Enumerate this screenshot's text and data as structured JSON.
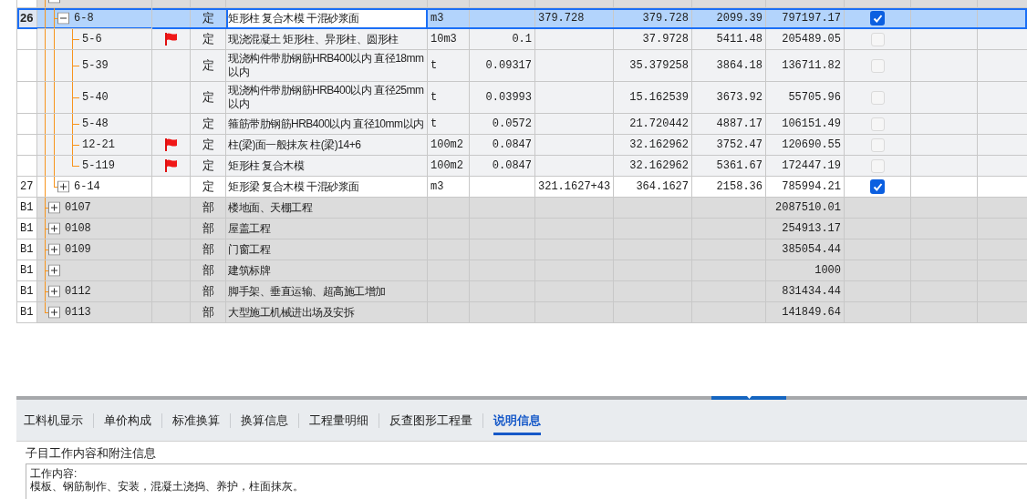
{
  "table": {
    "rows": [
      {
        "kind": "section",
        "expanded": true,
        "selected": false,
        "children": [
          {
            "kind": "item",
            "number": "26",
            "code": "6-8",
            "expanded": true,
            "selected": true,
            "flagged": false,
            "type": "定",
            "name": "矩形柱 复合木模 干混砂浆面",
            "unit": "m3",
            "expression": "379.728",
            "quantity": "379.728",
            "unit_price": "2099.39",
            "total": "797197.17",
            "checked": true,
            "children": [
              {
                "kind": "sub",
                "code": "5-6",
                "selected": false,
                "flagged": true,
                "type": "定",
                "name": "现浇混凝土 矩形柱、异形柱、圆形柱",
                "unit": "10m3",
                "content": "0.1",
                "quantity": "37.9728",
                "unit_price": "5411.48",
                "total": "205489.05",
                "checked": false
              },
              {
                "kind": "sub",
                "code": "5-39",
                "selected": false,
                "flagged": false,
                "type": "定",
                "name": "现浇构件带肋钢筋HRB400以内 直径18mm以内",
                "unit": "t",
                "content": "0.09317",
                "quantity": "35.379258",
                "unit_price": "3864.18",
                "total": "136711.82",
                "checked": false
              },
              {
                "kind": "sub",
                "code": "5-40",
                "selected": false,
                "flagged": false,
                "type": "定",
                "name": "现浇构件带肋钢筋HRB400以内 直径25mm以内",
                "unit": "t",
                "content": "0.03993",
                "quantity": "15.162539",
                "unit_price": "3673.92",
                "total": "55705.96",
                "checked": false
              },
              {
                "kind": "sub",
                "code": "5-48",
                "selected": false,
                "flagged": false,
                "type": "定",
                "name": "箍筋带肋钢筋HRB400以内 直径10mm以内",
                "unit": "t",
                "content": "0.0572",
                "quantity": "21.720442",
                "unit_price": "4887.17",
                "total": "106151.49",
                "checked": false
              },
              {
                "kind": "sub",
                "code": "12-21",
                "selected": false,
                "flagged": true,
                "type": "定",
                "name": "柱(梁)面一般抹灰 柱(梁)14+6",
                "unit": "100m2",
                "content": "0.0847",
                "quantity": "32.162962",
                "unit_price": "3752.47",
                "total": "120690.55",
                "checked": false
              },
              {
                "kind": "sub",
                "code": "5-119",
                "selected": false,
                "flagged": true,
                "type": "定",
                "name": "矩形柱 复合木模",
                "unit": "100m2",
                "content": "0.0847",
                "quantity": "32.162962",
                "unit_price": "5361.67",
                "total": "172447.19",
                "checked": false
              }
            ]
          },
          {
            "kind": "item",
            "number": "27",
            "code": "6-14",
            "expanded": false,
            "selected": false,
            "flagged": false,
            "type": "定",
            "name": "矩形梁 复合木模 干混砂浆面",
            "unit": "m3",
            "expression": "321.1627+43",
            "quantity": "364.1627",
            "unit_price": "2158.36",
            "total": "785994.21",
            "checked": true
          }
        ]
      },
      {
        "kind": "section",
        "number": "B1",
        "code": "0107",
        "expanded": false,
        "selected": false,
        "type": "部",
        "name": "楼地面、天棚工程",
        "total": "2087510.01"
      },
      {
        "kind": "section",
        "number": "B1",
        "code": "0108",
        "expanded": false,
        "selected": false,
        "type": "部",
        "name": "屋盖工程",
        "total": "254913.17"
      },
      {
        "kind": "section",
        "number": "B1",
        "code": "0109",
        "expanded": false,
        "selected": false,
        "type": "部",
        "name": "门窗工程",
        "total": "385054.44"
      },
      {
        "kind": "section",
        "number": "B1",
        "expanded": false,
        "selected": false,
        "type": "部",
        "name": "建筑标牌",
        "total": "1000"
      },
      {
        "kind": "section",
        "number": "B1",
        "code": "0112",
        "expanded": false,
        "selected": false,
        "type": "部",
        "name": "脚手架、垂直运输、超高施工增加",
        "total": "831434.44"
      },
      {
        "kind": "section",
        "number": "B1",
        "code": "0113",
        "expanded": false,
        "selected": false,
        "type": "部",
        "name": "大型施工机械进出场及安拆",
        "total": "141849.64"
      }
    ]
  },
  "bottom_tabs": [
    {
      "label": "工料机显示",
      "selected": false
    },
    {
      "label": "单价构成",
      "selected": false
    },
    {
      "label": "标准换算",
      "selected": false
    },
    {
      "label": "换算信息",
      "selected": false
    },
    {
      "label": "工程量明细",
      "selected": false
    },
    {
      "label": "反查图形工程量",
      "selected": false
    },
    {
      "label": "说明信息",
      "selected": true
    }
  ],
  "detail": {
    "title": "子目工作内容和附注信息",
    "text": "工作内容:\n模板、钢筋制作、安装，混凝土浇捣、养护，柱面抹灰。"
  }
}
